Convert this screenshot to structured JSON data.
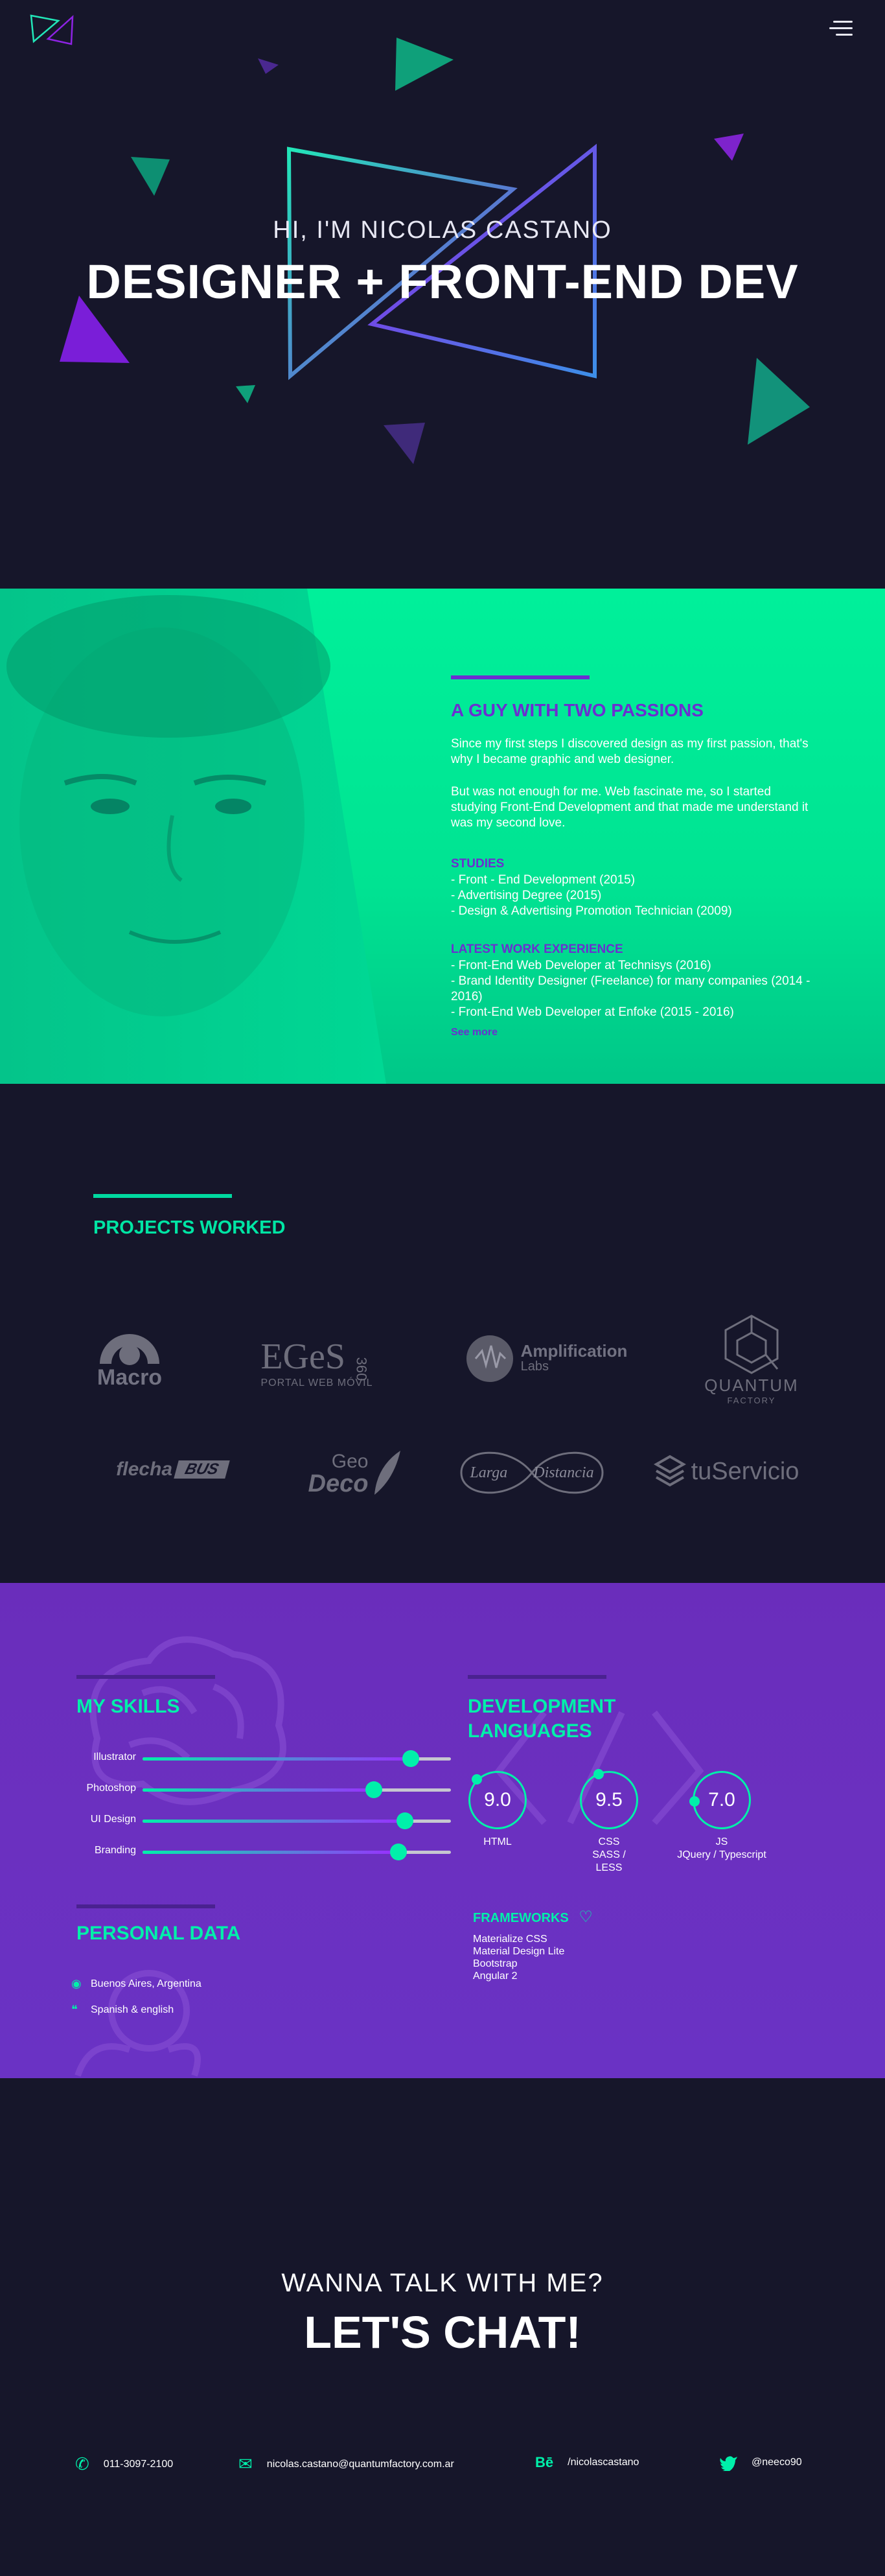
{
  "header": {
    "logo_icon": "triangle-logo-icon",
    "menu_icon": "hamburger-menu-icon"
  },
  "hero": {
    "greeting": "HI, I'M NICOLAS CASTANO",
    "title": "DESIGNER + FRONT-END DEV"
  },
  "about": {
    "heading": "A GUY WITH TWO PASSIONS",
    "para1": "Since my first steps I discovered design as my first passion, that's why I became graphic and web designer.",
    "para2": "But was not enough for me. Web fascinate me, so I started studying Front-End Development and that made me understand it was my second love.",
    "studies_label": "STUDIES",
    "studies": [
      "- Front - End Development (2015)",
      "- Advertising Degree (2015)",
      "- Design & Advertising Promotion Technician (2009)"
    ],
    "work_label": "LATEST WORK EXPERIENCE",
    "work": [
      "- Front-End Web Developer at Technisys (2016)",
      "- Brand Identity Designer (Freelance) for many companies (2014 - 2016)",
      "- Front-End Web Developer at Enfoke (2015 - 2016)"
    ],
    "see_more": "See more"
  },
  "projects": {
    "heading": "PROJECTS WORKED",
    "brands": [
      {
        "name": "Macro",
        "icon": "macro-logo-icon"
      },
      {
        "name": "EGeS",
        "extra": "360",
        "sub": "PORTAL WEB MÓVIL",
        "icon": "eges-logo-icon"
      },
      {
        "name": "Amplification",
        "sub": "Labs",
        "icon": "amplification-logo-icon"
      },
      {
        "name": "QUANTUM",
        "sub": "FACTORY",
        "icon": "quantum-cube-icon"
      },
      {
        "name": "flecha",
        "extra": "BUS",
        "icon": "flechabus-logo-icon"
      },
      {
        "name": "Geo",
        "sub": "Deco",
        "icon": "geodeco-leaf-icon"
      },
      {
        "name": "Larga",
        "sub": "Distancia",
        "icon": "infinity-icon"
      },
      {
        "name": "tuServicio",
        "icon": "layers-icon"
      }
    ]
  },
  "skills": {
    "skills_heading": "MY SKILLS",
    "items": [
      {
        "label": "Illustrator",
        "level": 0.87
      },
      {
        "label": "Photoshop",
        "level": 0.75
      },
      {
        "label": "UI Design",
        "level": 0.85
      },
      {
        "label": "Branding",
        "level": 0.83
      }
    ],
    "dev_heading": "DEVELOPMENT LANGUAGES",
    "languages": [
      {
        "score": "9.0",
        "label": "HTML",
        "label2": ""
      },
      {
        "score": "9.5",
        "label": "CSS",
        "label2": "SASS / LESS"
      },
      {
        "score": "7.0",
        "label": "JS",
        "label2": "JQuery / Typescript"
      }
    ],
    "personal_heading": "PERSONAL DATA",
    "personal": [
      {
        "icon": "location-pin-icon",
        "text": "Buenos Aires, Argentina"
      },
      {
        "icon": "chat-bubble-icon",
        "text": "Spanish & english"
      }
    ],
    "frameworks_heading": "FRAMEWORKS",
    "frameworks_icon": "heart-icon",
    "frameworks": [
      "Materialize CSS",
      "Material Design Lite",
      "Bootstrap",
      "Angular 2"
    ]
  },
  "contact": {
    "subtitle": "WANNA TALK WITH ME?",
    "title": "LET'S CHAT!",
    "items": [
      {
        "icon": "phone-icon",
        "text": "011-3097-2100"
      },
      {
        "icon": "email-icon",
        "text": "nicolas.castano@quantumfactory.com.ar"
      },
      {
        "icon": "behance-icon",
        "text": "/nicolascastano"
      },
      {
        "icon": "twitter-icon",
        "text": "@neeco90"
      }
    ]
  },
  "colors": {
    "background": "#16162a",
    "accent_green": "#00f0aa",
    "accent_purple": "#6b2fd0"
  }
}
